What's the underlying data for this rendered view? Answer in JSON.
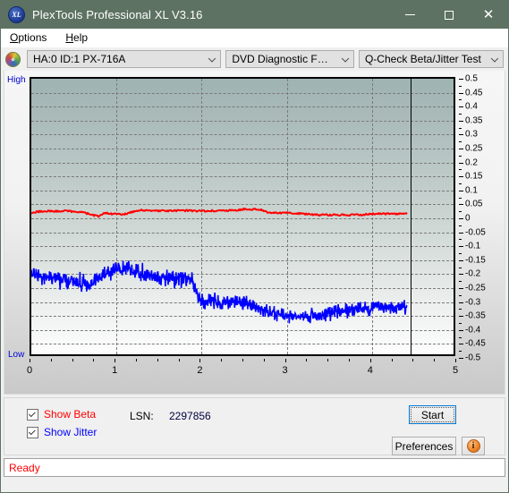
{
  "window": {
    "title": "PlexTools Professional XL V3.16",
    "icon": "xl-app-icon",
    "minimize_label": "—",
    "maximize_label": "□",
    "close_label": "✕"
  },
  "menubar": {
    "items": [
      {
        "label": "Options",
        "accel": "O"
      },
      {
        "label": "Help",
        "accel": "H"
      }
    ]
  },
  "toolbar": {
    "drive_icon": "optical-disc-icon",
    "drive_select": "HA:0 ID:1  PX-716A",
    "function_select": "DVD Diagnostic Functions",
    "test_select": "Q-Check Beta/Jitter Test"
  },
  "chart_labels": {
    "high": "High",
    "low": "Low"
  },
  "controls": {
    "show_beta_label": "Show Beta",
    "show_beta_accel": "B",
    "show_beta_checked": true,
    "show_beta_color": "#ff0000",
    "show_jitter_label": "Show Jitter",
    "show_jitter_accel": "J",
    "show_jitter_checked": true,
    "show_jitter_color": "#0000ff",
    "lsn_label": "LSN:",
    "lsn_value": "2297856",
    "start_label": "Start",
    "start_accel": "S",
    "preferences_label": "Preferences",
    "preferences_accel": "P",
    "info_label": "i",
    "info_icon": "info-icon"
  },
  "statusbar": {
    "text": "Ready",
    "color": "#ff0000"
  },
  "chart_data": {
    "type": "line",
    "title": "Q-Check Beta/Jitter Test",
    "xlabel": "",
    "ylabel": "",
    "xlim": [
      0,
      5
    ],
    "ylim": [
      -0.5,
      0.5
    ],
    "xticks": [
      0,
      1,
      2,
      3,
      4,
      5
    ],
    "yticks": [
      0.5,
      0.45,
      0.4,
      0.35,
      0.3,
      0.25,
      0.2,
      0.15,
      0.1,
      0.05,
      0,
      -0.05,
      -0.1,
      -0.15,
      -0.2,
      -0.25,
      -0.3,
      -0.35,
      -0.4,
      -0.45,
      -0.5
    ],
    "grid": true,
    "legend_position": "below-left",
    "data_end_marker_x": 4.45,
    "series": [
      {
        "name": "Show Beta",
        "color": "#ff0000",
        "x": [
          0.0,
          0.05,
          0.1,
          0.15,
          0.2,
          0.25,
          0.3,
          0.35,
          0.4,
          0.45,
          0.5,
          0.55,
          0.6,
          0.65,
          0.7,
          0.75,
          0.8,
          0.85,
          0.9,
          0.95,
          1.0,
          1.05,
          1.1,
          1.15,
          1.2,
          1.25,
          1.3,
          1.35,
          1.4,
          1.45,
          1.5,
          1.55,
          1.6,
          1.65,
          1.7,
          1.75,
          1.8,
          1.85,
          1.9,
          1.95,
          2.0,
          2.05,
          2.1,
          2.15,
          2.2,
          2.25,
          2.3,
          2.35,
          2.4,
          2.45,
          2.5,
          2.55,
          2.6,
          2.65,
          2.7,
          2.75,
          2.8,
          2.85,
          2.9,
          2.95,
          3.0,
          3.05,
          3.1,
          3.15,
          3.2,
          3.25,
          3.3,
          3.35,
          3.4,
          3.45,
          3.5,
          3.55,
          3.6,
          3.65,
          3.7,
          3.75,
          3.8,
          3.85,
          3.9,
          3.95,
          4.0,
          4.05,
          4.1,
          4.15,
          4.2,
          4.25,
          4.3,
          4.35,
          4.4,
          4.45
        ],
        "y": [
          0.012,
          0.016,
          0.019,
          0.02,
          0.02,
          0.019,
          0.019,
          0.019,
          0.02,
          0.019,
          0.018,
          0.017,
          0.015,
          0.012,
          0.008,
          0.004,
          0.001,
          0.01,
          0.012,
          0.01,
          0.009,
          0.008,
          0.008,
          0.012,
          0.017,
          0.021,
          0.024,
          0.022,
          0.021,
          0.021,
          0.021,
          0.021,
          0.021,
          0.02,
          0.021,
          0.021,
          0.021,
          0.021,
          0.021,
          0.02,
          0.02,
          0.02,
          0.021,
          0.021,
          0.021,
          0.022,
          0.022,
          0.022,
          0.022,
          0.024,
          0.026,
          0.027,
          0.025,
          0.026,
          0.026,
          0.022,
          0.015,
          0.013,
          0.013,
          0.013,
          0.013,
          0.013,
          0.012,
          0.011,
          0.01,
          0.009,
          0.008,
          0.007,
          0.006,
          0.006,
          0.006,
          0.006,
          0.006,
          0.006,
          0.006,
          0.006,
          0.006,
          0.006,
          0.006,
          0.007,
          0.01,
          0.01,
          0.01,
          0.01,
          0.01,
          0.01,
          0.01,
          0.01,
          0.01,
          0.01
        ]
      },
      {
        "name": "Show Jitter",
        "color": "#0000ff",
        "x": [
          0.0,
          0.05,
          0.1,
          0.15,
          0.2,
          0.25,
          0.3,
          0.35,
          0.4,
          0.45,
          0.5,
          0.55,
          0.6,
          0.65,
          0.7,
          0.75,
          0.8,
          0.85,
          0.9,
          0.95,
          1.0,
          1.05,
          1.1,
          1.15,
          1.2,
          1.25,
          1.3,
          1.35,
          1.4,
          1.45,
          1.5,
          1.55,
          1.6,
          1.65,
          1.7,
          1.75,
          1.8,
          1.85,
          1.9,
          1.95,
          2.0,
          2.05,
          2.1,
          2.15,
          2.2,
          2.25,
          2.3,
          2.35,
          2.4,
          2.45,
          2.5,
          2.55,
          2.6,
          2.65,
          2.7,
          2.75,
          2.8,
          2.85,
          2.9,
          2.95,
          3.0,
          3.05,
          3.1,
          3.15,
          3.2,
          3.25,
          3.3,
          3.35,
          3.4,
          3.45,
          3.5,
          3.55,
          3.6,
          3.65,
          3.7,
          3.75,
          3.8,
          3.85,
          3.9,
          3.95,
          4.0,
          4.05,
          4.1,
          4.15,
          4.2,
          4.25,
          4.3,
          4.35,
          4.4,
          4.45
        ],
        "y_mean": [
          -0.205,
          -0.215,
          -0.222,
          -0.225,
          -0.227,
          -0.228,
          -0.23,
          -0.232,
          -0.234,
          -0.236,
          -0.24,
          -0.243,
          -0.244,
          -0.242,
          -0.238,
          -0.232,
          -0.224,
          -0.214,
          -0.205,
          -0.197,
          -0.19,
          -0.186,
          -0.183,
          -0.185,
          -0.192,
          -0.2,
          -0.206,
          -0.21,
          -0.213,
          -0.215,
          -0.217,
          -0.218,
          -0.219,
          -0.22,
          -0.221,
          -0.222,
          -0.222,
          -0.222,
          -0.222,
          -0.28,
          -0.3,
          -0.305,
          -0.308,
          -0.31,
          -0.312,
          -0.314,
          -0.315,
          -0.313,
          -0.311,
          -0.31,
          -0.312,
          -0.315,
          -0.32,
          -0.326,
          -0.332,
          -0.338,
          -0.344,
          -0.349,
          -0.353,
          -0.356,
          -0.358,
          -0.36,
          -0.362,
          -0.363,
          -0.364,
          -0.364,
          -0.363,
          -0.361,
          -0.358,
          -0.355,
          -0.352,
          -0.349,
          -0.346,
          -0.344,
          -0.342,
          -0.34,
          -0.338,
          -0.336,
          -0.334,
          -0.332,
          -0.331,
          -0.33,
          -0.329,
          -0.328,
          -0.327,
          -0.327,
          -0.327,
          -0.327,
          -0.328,
          -0.33
        ],
        "noise_amplitude": 0.035,
        "noise_amplitude_tail": 0.028
      }
    ]
  }
}
